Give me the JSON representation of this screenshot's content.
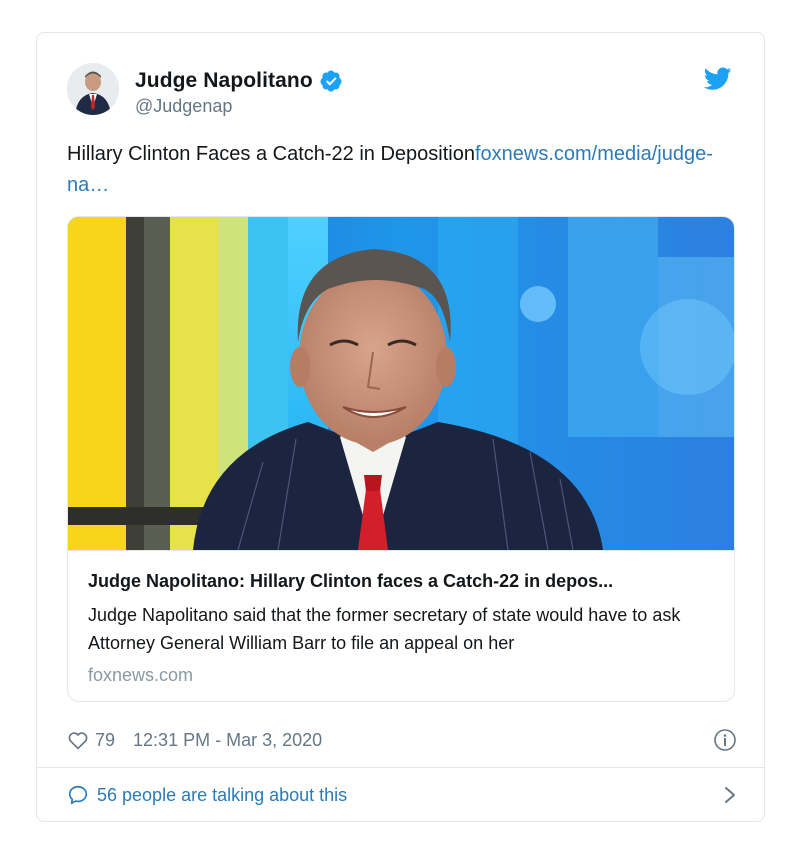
{
  "tweet": {
    "author": {
      "display_name": "Judge Napolitano",
      "handle": "@Judgenap",
      "verified_icon": "verified-badge-icon",
      "avatar": "avatar"
    },
    "text_plain": "Hillary Clinton Faces a Catch-22 in Deposition",
    "text_link": "foxnews.com/media/judge-na…",
    "link_card": {
      "image": "man-in-pinstripe-suit-on-news-set",
      "title": "Judge Napolitano: Hillary Clinton faces a Catch-22 in depos...",
      "description": "Judge Napolitano said that the former secretary of state would have to ask Attorney General William Barr to file an appeal on her",
      "domain": "foxnews.com"
    },
    "likes": "79",
    "timestamp": "12:31 PM - Mar 3, 2020",
    "talking_text": "56 people are talking about this"
  },
  "icons": {
    "brand": "twitter-bird-icon",
    "like": "heart-icon",
    "info": "info-icon",
    "conversation": "speech-bubble-icon",
    "chevron": "chevron-right-icon"
  },
  "colors": {
    "link": "#2b7bb9",
    "verified": "#1da1f2",
    "secondary_text": "#657786",
    "border": "#e1e8ed"
  }
}
